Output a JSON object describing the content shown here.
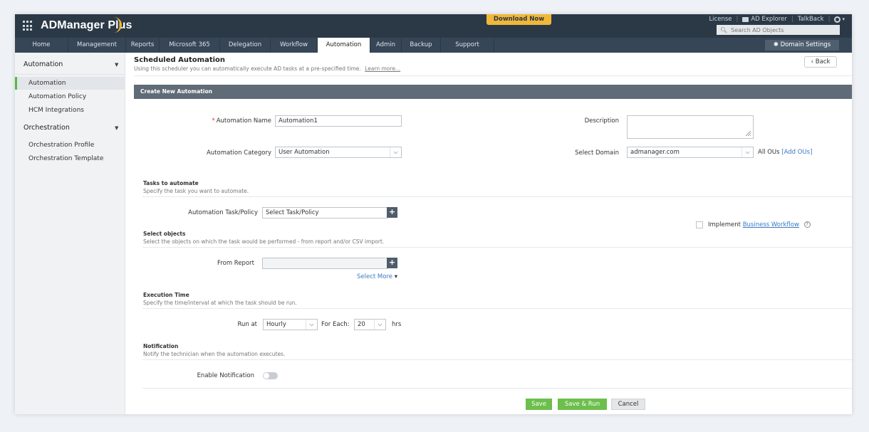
{
  "app": {
    "name": "ADManager Plus"
  },
  "header": {
    "download_label": "Download Now",
    "links": [
      "License",
      "AD Explorer",
      "TalkBack"
    ],
    "search_placeholder": "Search AD Objects"
  },
  "nav": {
    "tabs": [
      "Home",
      "Management",
      "Reports",
      "Microsoft 365",
      "Delegation",
      "Workflow",
      "Automation",
      "Admin",
      "Backup",
      "Support"
    ],
    "active": "Automation",
    "domain_settings": "Domain Settings"
  },
  "sidebar": {
    "group1": "Automation",
    "group1_items": [
      "Automation",
      "Automation Policy",
      "HCM Integrations"
    ],
    "group2": "Orchestration",
    "group2_items": [
      "Orchestration Profile",
      "Orchestration Template"
    ]
  },
  "page": {
    "title": "Scheduled Automation",
    "subtitle": "Using this scheduler you can automatically execute AD tasks at a pre-specified time.",
    "learn_more": "Learn more...",
    "back": "Back"
  },
  "form": {
    "section_title": "Create New Automation",
    "name_label": "Automation Name",
    "name_value": "Automation1",
    "description_label": "Description",
    "category_label": "Automation Category",
    "category_value": "User Automation",
    "domain_label": "Select Domain",
    "domain_value": "admanager.com",
    "all_ous": "All OUs",
    "add_ous": "[Add OUs]",
    "tasks_head": "Tasks to automate",
    "tasks_desc": "Specify the task you want to automate.",
    "task_label": "Automation Task/Policy",
    "task_value": "Select Task/Policy",
    "implement_label": "Implement",
    "business_workflow": "Business Workflow",
    "objects_head": "Select objects",
    "objects_desc": "Select the objects on which the task would be performed - from report and/or CSV import.",
    "from_report_label": "From Report",
    "select_more": "Select More",
    "exec_head": "Execution Time",
    "exec_desc": "Specify the time/interval at which the task should be run.",
    "run_at_label": "Run at",
    "run_at_value": "Hourly",
    "for_each_label": "For Each:",
    "for_each_value": "20",
    "hrs": "hrs",
    "notif_head": "Notification",
    "notif_desc": "Notify the technician when the automation executes.",
    "enable_notif_label": "Enable Notification",
    "save": "Save",
    "save_run": "Save & Run",
    "cancel": "Cancel"
  }
}
